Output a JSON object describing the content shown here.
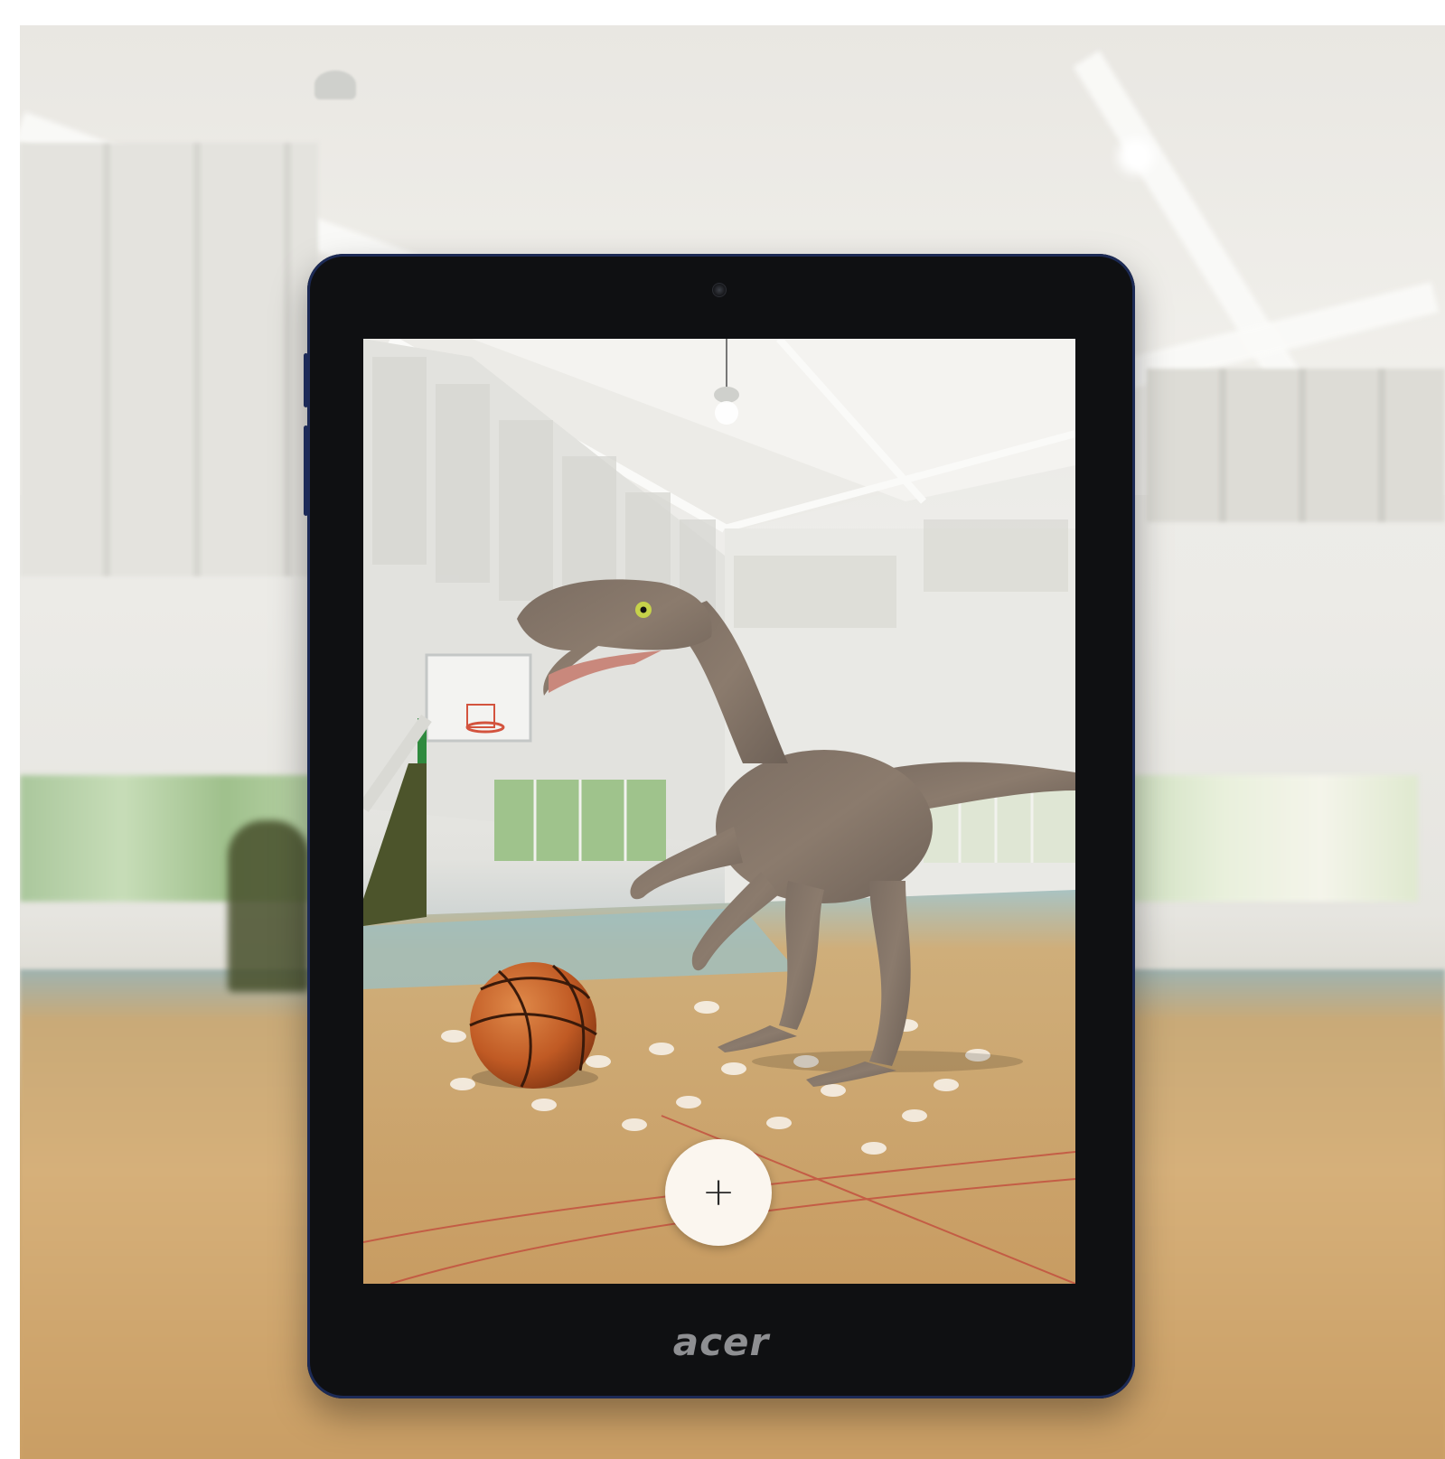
{
  "scene": {
    "tablet_brand": "acer",
    "ar_add_button": {
      "icon": "plus-icon",
      "glyph": "+"
    }
  },
  "colors": {
    "tablet_frame": "#0f1012",
    "tablet_edge": "#1c2a55",
    "button_bg": "#fbf6ef",
    "basketball": "#c8602a",
    "floor": "#d1ab73"
  }
}
